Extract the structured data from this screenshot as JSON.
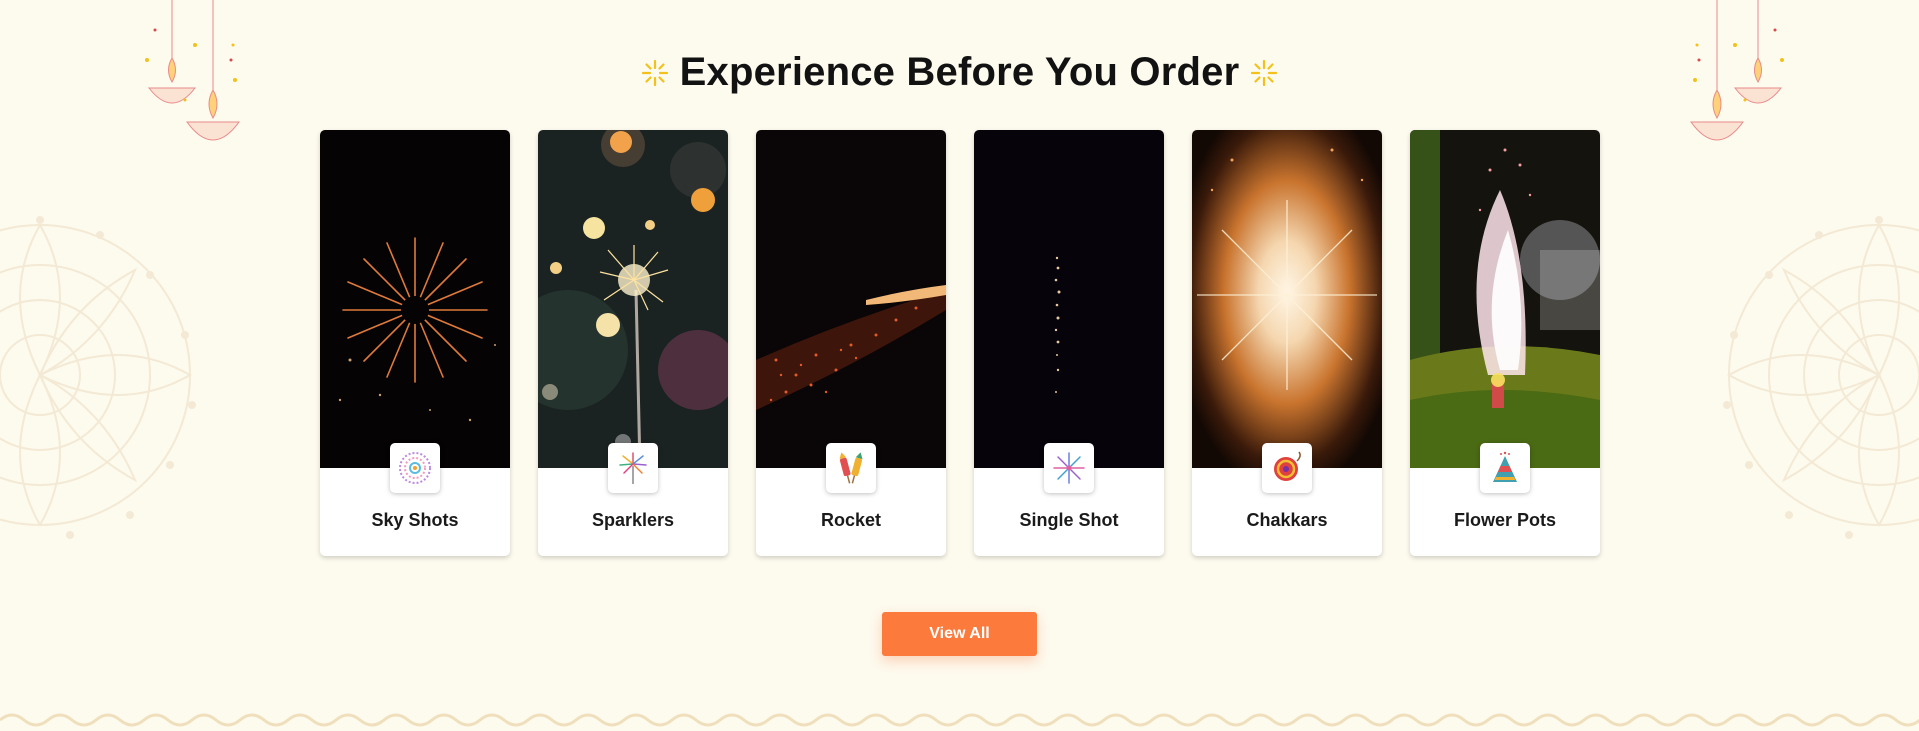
{
  "section": {
    "title": "Experience Before You Order",
    "view_all_label": "View All"
  },
  "categories": [
    {
      "label": "Sky Shots",
      "icon": "sky-shots-icon"
    },
    {
      "label": "Sparklers",
      "icon": "sparklers-icon"
    },
    {
      "label": "Rocket",
      "icon": "rocket-icon"
    },
    {
      "label": "Single Shot",
      "icon": "single-shot-icon"
    },
    {
      "label": "Chakkars",
      "icon": "chakkar-icon"
    },
    {
      "label": "Flower Pots",
      "icon": "flower-pot-icon"
    }
  ],
  "colors": {
    "background": "#fdfaee",
    "accent": "#fb7a3c",
    "sparkle": "#f2c21b",
    "heading": "#121212"
  }
}
